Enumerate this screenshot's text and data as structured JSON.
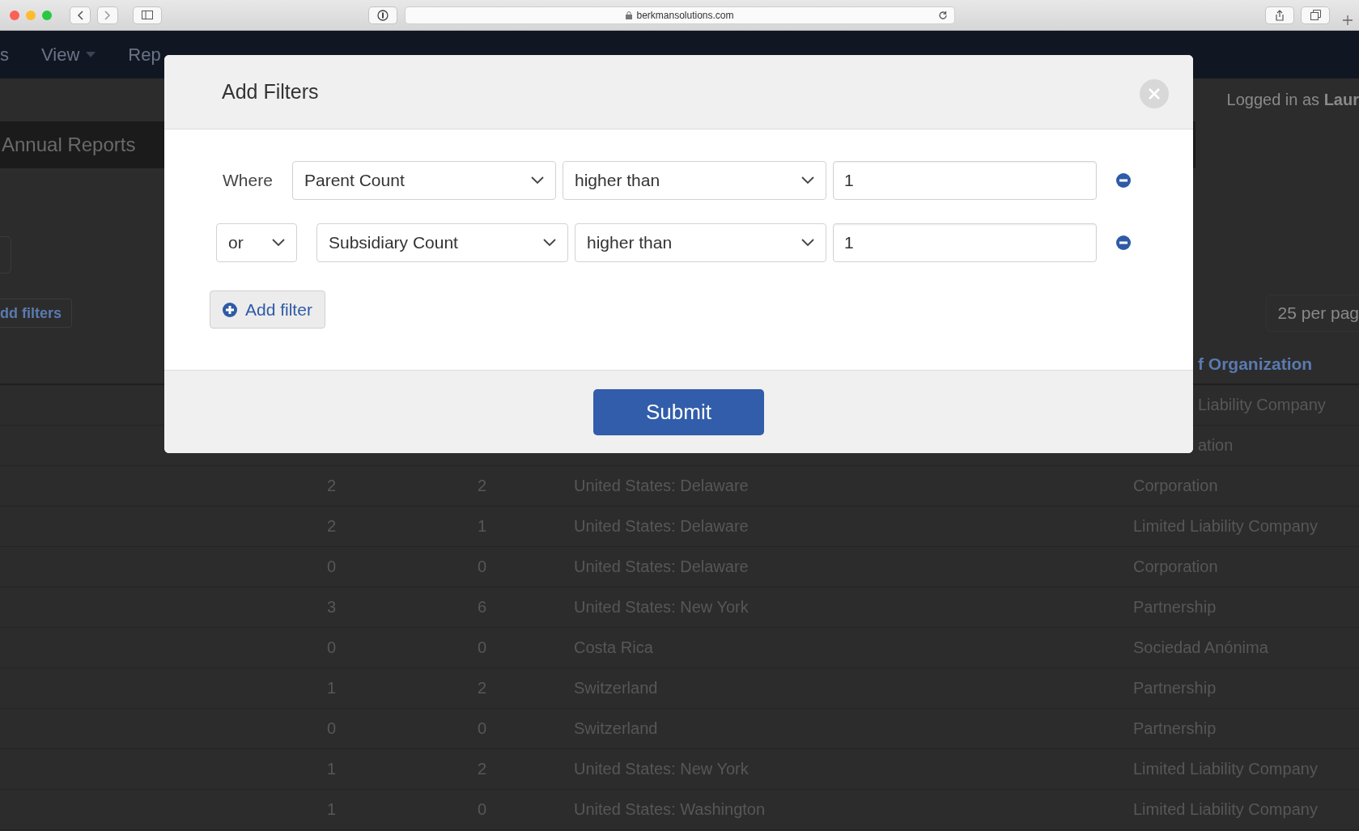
{
  "browser": {
    "url": "berkmansolutions.com"
  },
  "nav": [
    {
      "label": "s",
      "dropdown": false
    },
    {
      "label": "View",
      "dropdown": true
    },
    {
      "label": "Rep",
      "dropdown": false
    }
  ],
  "user": {
    "prefix": "Logged in as",
    "name": "Laur"
  },
  "toolbar": {
    "title": "Annual Reports"
  },
  "add_filters_button": "dd filters",
  "per_page": "25 per pag",
  "table": {
    "header": {
      "column_4": "f Organization"
    },
    "rows": [
      {
        "column_4": "Liability Company"
      },
      {
        "column_4": "ation"
      },
      {
        "column_1": "2",
        "column_2": "2",
        "column_3": "United States: Delaware",
        "column_4": "Corporation"
      },
      {
        "column_1": "2",
        "column_2": "1",
        "column_3": "United States: Delaware",
        "column_4": "Limited Liability Company"
      },
      {
        "column_1": "0",
        "column_2": "0",
        "column_3": "United States: Delaware",
        "column_4": "Corporation"
      },
      {
        "column_1": "3",
        "column_2": "6",
        "column_3": "United States: New York",
        "column_4": "Partnership"
      },
      {
        "column_1": "0",
        "column_2": "0",
        "column_3": "Costa Rica",
        "column_4": "Sociedad Anónima"
      },
      {
        "column_1": "1",
        "column_2": "2",
        "column_3": "Switzerland",
        "column_4": "Partnership"
      },
      {
        "column_1": "0",
        "column_2": "0",
        "column_3": "Switzerland",
        "column_4": "Partnership"
      },
      {
        "column_1": "1",
        "column_2": "2",
        "column_3": "United States: New York",
        "column_4": "Limited Liability Company"
      },
      {
        "column_1": "1",
        "column_2": "0",
        "column_3": "United States: Washington",
        "column_4": "Limited Liability Company"
      }
    ]
  },
  "modal": {
    "title": "Add Filters",
    "filters": [
      {
        "connector": {
          "kind": "label",
          "text": "Where"
        },
        "field": "Parent Count",
        "operator": "higher than",
        "value": "1"
      },
      {
        "connector": {
          "kind": "select",
          "text": "or"
        },
        "field": "Subsidiary Count",
        "operator": "higher than",
        "value": "1"
      }
    ],
    "add_button": "Add filter",
    "submit": "Submit"
  }
}
